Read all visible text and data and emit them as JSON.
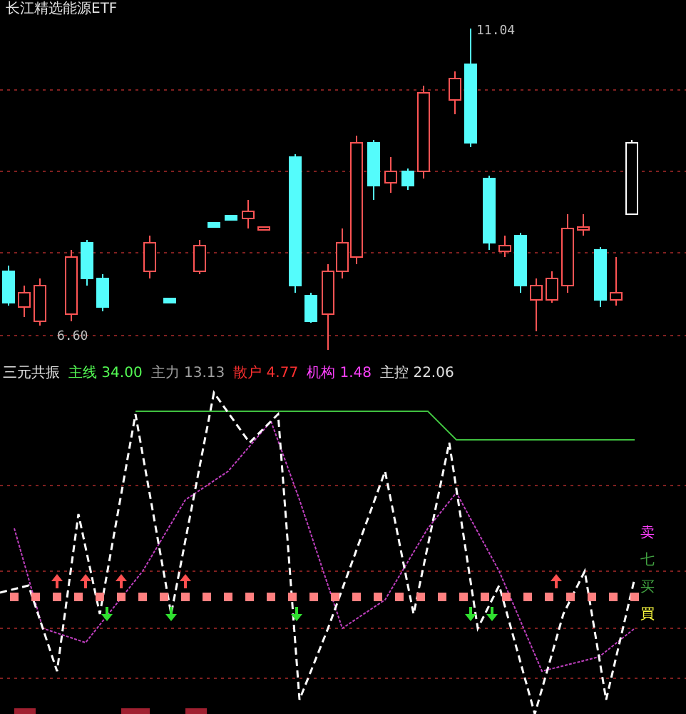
{
  "window": {
    "title": "长江精选能源ETF"
  },
  "price_chart": {
    "high_label": "11.04",
    "low_label": "6.60"
  },
  "indicator": {
    "legend": [
      {
        "text": "三元共振",
        "color": "#e0e0e0"
      },
      {
        "text": "主线 34.00",
        "color": "#54fc54"
      },
      {
        "text": "主力 13.13",
        "color": "#a0a0a0"
      },
      {
        "text": "散户 4.77",
        "color": "#ff3030"
      },
      {
        "text": "机构 1.48",
        "color": "#ff40ff"
      },
      {
        "text": "主控 22.06",
        "color": "#e0e0e0"
      }
    ],
    "side_labels": [
      {
        "text": "卖",
        "color": "#ff40ff"
      },
      {
        "text": "七",
        "color": "#40a040"
      },
      {
        "text": "买",
        "color": "#40a040"
      },
      {
        "text": "買",
        "color": "#ffff40"
      }
    ]
  }
}
